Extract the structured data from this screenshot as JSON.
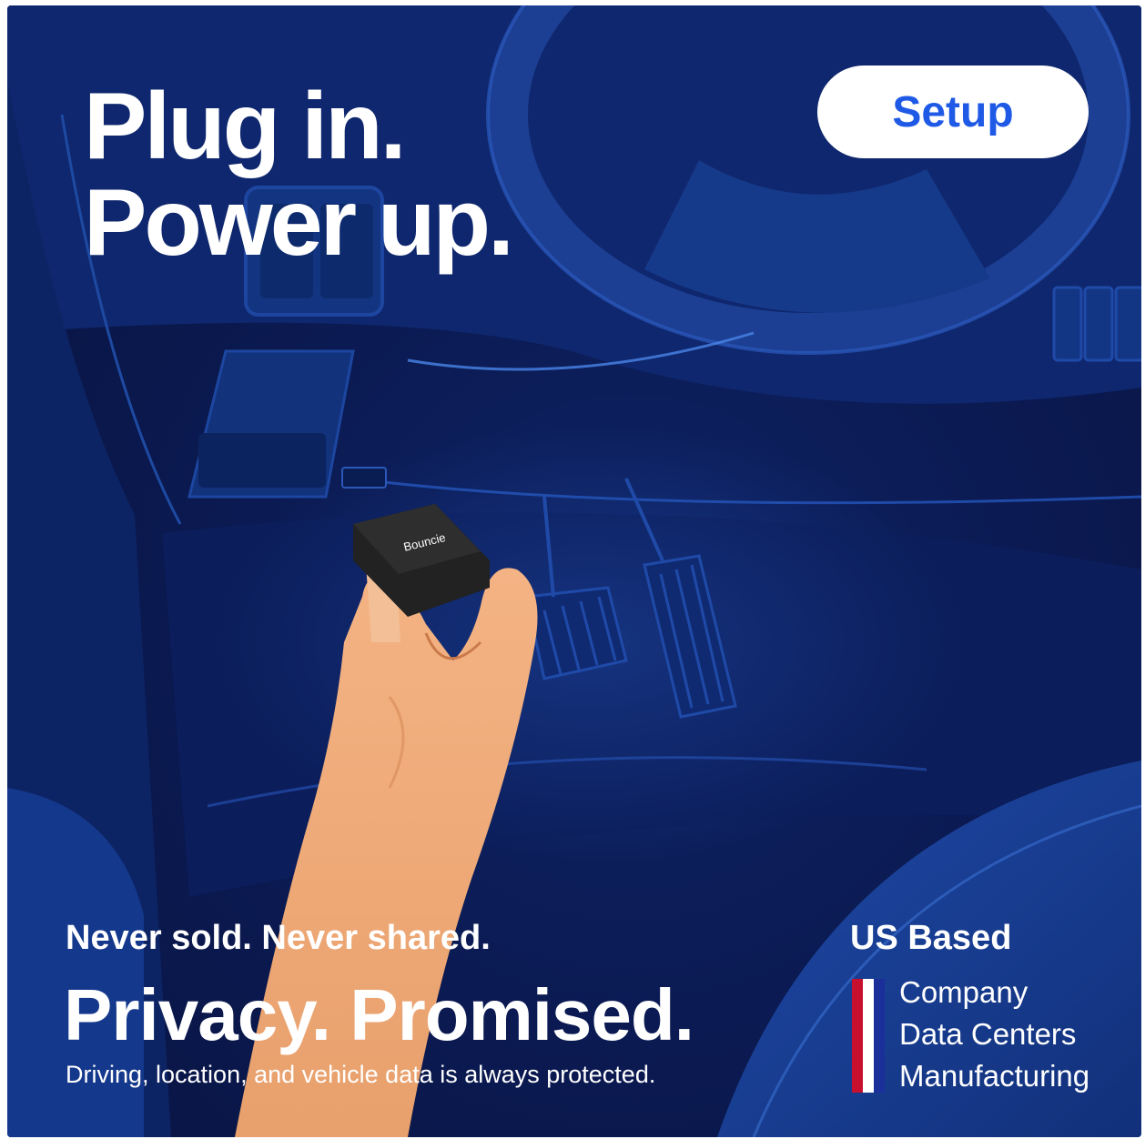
{
  "headline": {
    "line1": "Plug in.",
    "line2": "Power up."
  },
  "setup_button": {
    "label": "Setup"
  },
  "device": {
    "brand": "Bouncie"
  },
  "privacy": {
    "tagline": "Never sold. Never shared.",
    "headline": "Privacy. Promised.",
    "subtext": "Driving, location, and vehicle data is always protected."
  },
  "us_based": {
    "title": "US Based",
    "items": [
      "Company",
      "Data Centers",
      "Manufacturing"
    ]
  },
  "colors": {
    "background": "#0b1a52",
    "button_text": "#1f5ae6",
    "flag_red": "#c8102e",
    "flag_white": "#ffffff",
    "flag_blue": "#1a2f9a"
  },
  "icons": {
    "flag": "us-flag-stripes-icon"
  }
}
